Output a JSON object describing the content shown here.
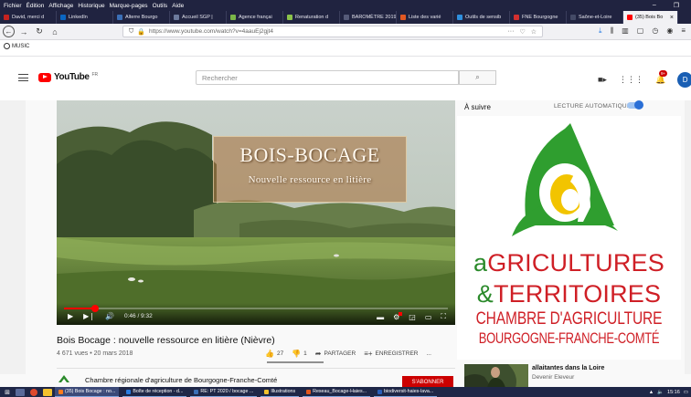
{
  "menubar": {
    "items": [
      "Fichier",
      "Édition",
      "Affichage",
      "Historique",
      "Marque-pages",
      "Outils",
      "Aide"
    ]
  },
  "tabs": [
    {
      "label": "David, merci d",
      "color": "#c5221f"
    },
    {
      "label": "LinkedIn",
      "color": "#0a66c2"
    },
    {
      "label": "Alterre Bourgo",
      "color": "#3b6fb6"
    },
    {
      "label": "Accueil SGP |",
      "color": "#6c7a9c"
    },
    {
      "label": "Agence françai",
      "color": "#7ab648"
    },
    {
      "label": "Renaturation d",
      "color": "#8bc34a"
    },
    {
      "label": "BAROMÈTRE 2019",
      "color": "#555a78"
    },
    {
      "label": "Liste des varié",
      "color": "#e25822"
    },
    {
      "label": "Outils de sensib",
      "color": "#2f8fdd"
    },
    {
      "label": "FNE Bourgogne",
      "color": "#d32f2f"
    },
    {
      "label": "Saône-et-Loire",
      "color": "#444a66"
    },
    {
      "label": "(35) Bois Bo",
      "color": "#ff0000",
      "active": true
    }
  ],
  "browser": {
    "url": "https://www.youtube.com/watch?v=4aauEj2gjt4",
    "music_label": "MUSIC"
  },
  "youtube": {
    "logo_text": "YouTube",
    "logo_sup": "FR",
    "search_placeholder": "Rechercher",
    "notif_count": "9+",
    "avatar_letter": "D"
  },
  "video": {
    "card_title": "BOIS-BOCAGE",
    "card_subtitle": "Nouvelle ressource en litière",
    "time": "0:46 / 9:32",
    "progress_fraction": 0.08,
    "title": "Bois Bocage : nouvelle ressource en litière (Nièvre)",
    "views_date": "4 671 vues • 20 mars 2018",
    "likes": "27",
    "dislikes": "1",
    "share_label": "PARTAGER",
    "save_label": "ENREGISTRER",
    "more_label": "..."
  },
  "channel": {
    "name": "Chambre régionale d'agriculture de Bourgogne-Franche-Comté",
    "subscribe_label": "S'ABONNER"
  },
  "sidebar": {
    "up_next": "À suivre",
    "autoplay": "LECTURE AUTOMATIQUE",
    "logo_line1_a": "a",
    "logo_line1_rest": "GRICULTURES",
    "logo_line2_amp": "&",
    "logo_line2_rest": "TERRITOIRES",
    "logo_line3": "CHAMBRE D'AGRICULTURE",
    "logo_line4": "BOURGOGNE-FRANCHE-COMTÉ",
    "suggestion_title": "allaitantes dans la Loire",
    "suggestion_channel": "Devenir Eleveur"
  },
  "taskbar": {
    "apps": [
      {
        "label": "(35) Bois Bocage : no...",
        "color": "#ff7b1c",
        "active": true
      },
      {
        "label": "Boîte de réception - d...",
        "color": "#2a7de1"
      },
      {
        "label": "RE: PT 2020 / bocage ...",
        "color": "#3b6fb6"
      },
      {
        "label": "Illustrations",
        "color": "#f2c12e"
      },
      {
        "label": "Reseau_Bocage-Haies...",
        "color": "#e2571e"
      },
      {
        "label": "biodiversit-haies-lava...",
        "color": "#2b5eb8"
      }
    ],
    "clock": "15:16"
  }
}
